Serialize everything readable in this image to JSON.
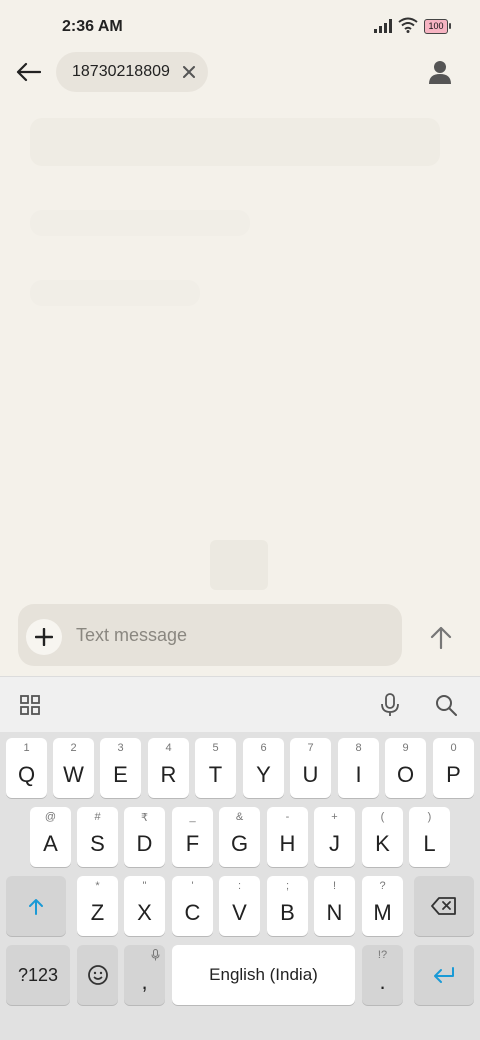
{
  "status_bar": {
    "time": "2:36 AM",
    "battery": "100"
  },
  "header": {
    "recipient": "18730218809"
  },
  "composer": {
    "placeholder": "Text message"
  },
  "keyboard": {
    "row1": [
      {
        "letter": "Q",
        "hint": "1"
      },
      {
        "letter": "W",
        "hint": "2"
      },
      {
        "letter": "E",
        "hint": "3"
      },
      {
        "letter": "R",
        "hint": "4"
      },
      {
        "letter": "T",
        "hint": "5"
      },
      {
        "letter": "Y",
        "hint": "6"
      },
      {
        "letter": "U",
        "hint": "7"
      },
      {
        "letter": "I",
        "hint": "8"
      },
      {
        "letter": "O",
        "hint": "9"
      },
      {
        "letter": "P",
        "hint": "0"
      }
    ],
    "row2": [
      {
        "letter": "A",
        "hint": "@"
      },
      {
        "letter": "S",
        "hint": "#"
      },
      {
        "letter": "D",
        "hint": "₹"
      },
      {
        "letter": "F",
        "hint": "_"
      },
      {
        "letter": "G",
        "hint": "&"
      },
      {
        "letter": "H",
        "hint": "-"
      },
      {
        "letter": "J",
        "hint": "+"
      },
      {
        "letter": "K",
        "hint": "("
      },
      {
        "letter": "L",
        "hint": ")"
      }
    ],
    "row3": [
      {
        "letter": "Z",
        "hint": "*"
      },
      {
        "letter": "X",
        "hint": "\""
      },
      {
        "letter": "C",
        "hint": "'"
      },
      {
        "letter": "V",
        "hint": ":"
      },
      {
        "letter": "B",
        "hint": ";"
      },
      {
        "letter": "N",
        "hint": "!"
      },
      {
        "letter": "M",
        "hint": "?"
      }
    ],
    "symbols_label": "?123",
    "comma": ",",
    "space_label": "English (India)",
    "period": ".",
    "period_hint": "!?"
  },
  "colors": {
    "accent": "#1a9ad6",
    "background": "#f4f1ea"
  }
}
